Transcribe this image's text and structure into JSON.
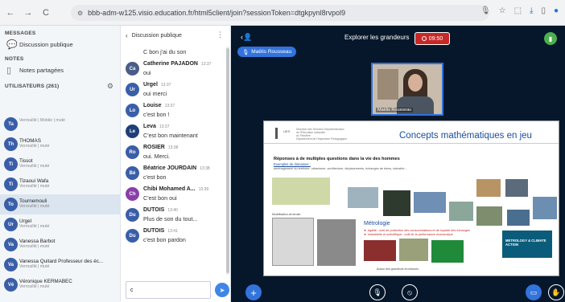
{
  "browser": {
    "url": "bbb-adm-w125.visio.education.fr/html5client/join?sessionToken=dtgkpynl8rvpol9",
    "back": "←",
    "forward": "→",
    "reload": "C"
  },
  "sidebar": {
    "messages_head": "MESSAGES",
    "public_chat": "Discussion publique",
    "notes_head": "NOTES",
    "shared_notes": "Notes partagées",
    "users_head": "UTILISATEURS (261)",
    "users": [
      {
        "initials": "Ta",
        "name": "",
        "status": "Verrouillé | Mobile | muté",
        "color": "#3a5ea8"
      },
      {
        "initials": "Th",
        "name": "THOMAS",
        "status": "Verrouillé | muté",
        "color": "#3a5ea8"
      },
      {
        "initials": "Ti",
        "name": "Tissot",
        "status": "Verrouillé | muté",
        "color": "#3a5ea8"
      },
      {
        "initials": "Ti",
        "name": "Tizaoui Wafa",
        "status": "Verrouillé | muté",
        "color": "#3a5ea8"
      },
      {
        "initials": "To",
        "name": "Tournemouli",
        "status": "Verrouillé | muté",
        "color": "#3a5ea8"
      },
      {
        "initials": "Ur",
        "name": "Urgel",
        "status": "Verrouillé | muté",
        "color": "#3a5ea8"
      },
      {
        "initials": "Va",
        "name": "Vanessa Barbot",
        "status": "Verrouillé | muté",
        "color": "#3a5ea8"
      },
      {
        "initials": "Va",
        "name": "Vanessa Quitard Professeur des éc...",
        "status": "Verrouillé | muté",
        "color": "#3a5ea8"
      },
      {
        "initials": "Vé",
        "name": "Véronique KERMABEC",
        "status": "Verrouillé | muté",
        "color": "#3a5ea8"
      }
    ]
  },
  "chat": {
    "title": "Discussion publique",
    "first_text": "C bon j'ai du son",
    "messages": [
      {
        "initials": "Ca",
        "name": "Catherine PAJADON",
        "time": "13:37",
        "texts": [
          "oui"
        ],
        "color": "#4a5c8a"
      },
      {
        "initials": "Ur",
        "name": "Urgel",
        "time": "13:37",
        "texts": [
          "oui merci"
        ],
        "color": "#3a5ea8"
      },
      {
        "initials": "Lo",
        "name": "Louise",
        "time": "13:37",
        "texts": [
          "c'est bon !"
        ],
        "color": "#3a5ea8"
      },
      {
        "initials": "Le",
        "name": "Leva",
        "time": "13:37",
        "texts": [
          "C'est bon maintenant"
        ],
        "color": "#1f3f7a"
      },
      {
        "initials": "Ro",
        "name": "ROSIER",
        "time": "13:38",
        "texts": [
          "oui. Merci."
        ],
        "color": "#3a5ea8"
      },
      {
        "initials": "Bé",
        "name": "Béatrice JOURDAIN",
        "time": "13:38",
        "texts": [
          "c'est bon"
        ],
        "color": "#3a5ea8"
      },
      {
        "initials": "Ch",
        "name": "Chibi Mohamed A...",
        "time": "13:39",
        "texts": [
          "C'est bon oui"
        ],
        "color": "#8a3fa8"
      },
      {
        "initials": "Du",
        "name": "DUTOIS",
        "time": "13:40",
        "texts": [
          "Plus de son du tout..."
        ],
        "color": "#3a5ea8"
      },
      {
        "initials": "Du",
        "name": "DUTOIS",
        "time": "13:41",
        "texts": [
          "c'est bon pardon"
        ],
        "color": "#3a5ea8"
      }
    ],
    "input_value": "c"
  },
  "stage": {
    "title": "Explorer les grandeurs",
    "rec_time": "09:50",
    "presenter": "Maëlis Rousseau",
    "webcam_label": "Maëlis Rousseau",
    "slide": {
      "title": "Concepts mathématiques en jeu",
      "inst": "UES",
      "inst2_l1": "Direction des Services Départementaux",
      "inst2_l2": "de l'Éducation nationale",
      "inst2_l3": "du Finistère",
      "inst2_l4": "Département de l'Inspection Pédagogique",
      "heading": "Réponses à de multiples questions dans la vie des hommes",
      "sub": "Exemples de domaines :",
      "sub2": "aménagement du territoire, urbanisme, architecture, déplacements, échanges de biens, industrie...",
      "metrology": "Métrologie",
      "metro_l1": "► égalité : outil de protection des consommateurs et de loyauté des échanges",
      "metro_l2": "► industrielle et scientifique : outil de la performance économique",
      "cap_bottom": "Autour des grandeurs et mesures",
      "cap_plan": "Modélisation de terrain",
      "metrology_badge": "METROLOGY & CLIMATE ACTION"
    }
  },
  "colors": {
    "accent": "#3273dc",
    "rec": "#c62828",
    "stage_bg": "#06172b"
  }
}
